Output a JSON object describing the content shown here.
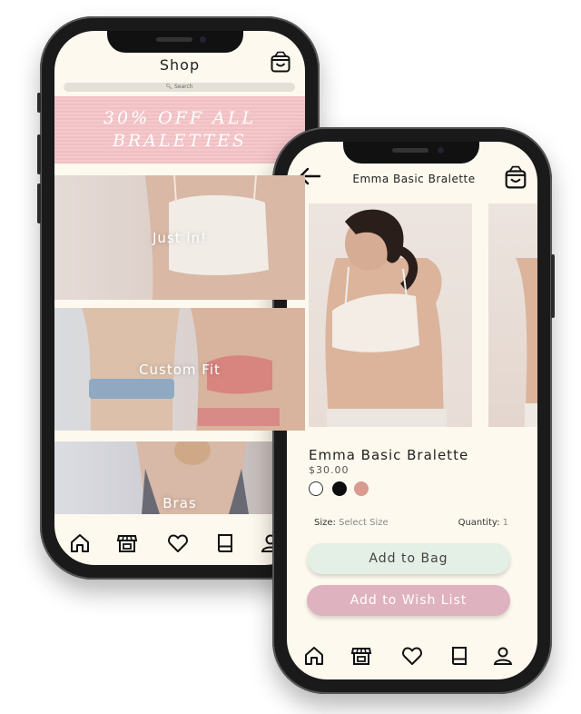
{
  "shop_screen": {
    "title": "Shop",
    "search_placeholder": "Search",
    "promo_text": "30% OFF ALL BRALETTES",
    "categories": [
      {
        "label": "Just in!"
      },
      {
        "label": "Custom Fit"
      },
      {
        "label": "Bras"
      }
    ],
    "nav": [
      "home-icon",
      "store-icon",
      "heart-icon",
      "book-icon",
      "user-icon"
    ]
  },
  "product_screen": {
    "header_title": "Emma Basic Bralette",
    "product_name": "Emma Basic Bralette",
    "price": "$30.00",
    "swatches": [
      "#ffffff",
      "#0d0d0d",
      "#d99b90"
    ],
    "size_label": "Size:",
    "size_value": "Select Size",
    "quantity_label": "Quantity:",
    "quantity_value": "1",
    "add_to_bag": "Add to Bag",
    "add_to_wishlist": "Add to Wish List",
    "nav": [
      "home-icon",
      "store-icon",
      "heart-icon",
      "book-icon",
      "user-icon"
    ]
  },
  "colors": {
    "screen_bg": "#fdf9ee",
    "promo_bg": "#f1bfc3",
    "bag_button_bg": "#e4efe5",
    "wishlist_button_bg": "#dfb2c0"
  }
}
